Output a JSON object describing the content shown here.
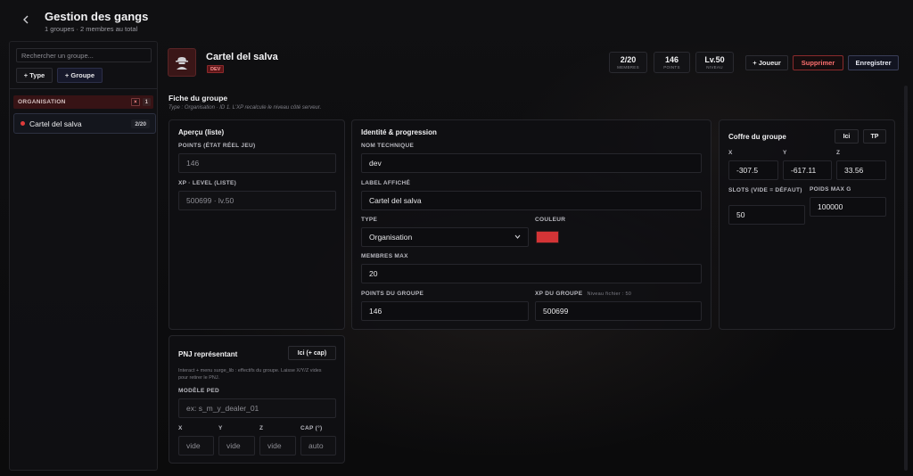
{
  "header": {
    "title": "Gestion des gangs",
    "subtitle": "1 groupes · 2 membres au total"
  },
  "sidebar": {
    "search_placeholder": "Rechercher un groupe...",
    "type_button": "+ Type",
    "group_button": "+ Groupe",
    "category": {
      "label": "ORGANISATION",
      "remove": "×",
      "count": "1"
    },
    "groups": [
      {
        "label": "Cartel del salva",
        "count": "2/20",
        "color": "#e03b3b"
      }
    ]
  },
  "group": {
    "name": "Cartel del salva",
    "badge": "DEV",
    "stats": [
      {
        "value": "2/20",
        "label": "MEMBRES"
      },
      {
        "value": "146",
        "label": "POINTS"
      },
      {
        "value": "Lv.50",
        "label": "NIVEAU"
      }
    ],
    "buttons": {
      "player": "+ Joueur",
      "delete": "Supprimer",
      "save": "Enregistrer"
    }
  },
  "form": {
    "title": "Fiche du groupe",
    "subtitle": "Type : Organisation · ID 1. L'XP recalcule le niveau côté serveur.",
    "overview": {
      "title": "Aperçu (liste)",
      "points_label": "POINTS (ÉTAT RÉEL JEU)",
      "points_value": "146",
      "xp_label": "XP · LEVEL (LISTE)",
      "xp_value": "500699 · lv.50"
    },
    "identity": {
      "title": "Identité & progression",
      "tech_name_label": "NOM TECHNIQUE",
      "tech_name_value": "dev",
      "display_label": "LABEL AFFICHÉ",
      "display_value": "Cartel del salva",
      "type_label": "TYPE",
      "type_value": "Organisation",
      "color_label": "COULEUR",
      "color_value": "#d33436",
      "max_members_label": "MEMBRES MAX",
      "max_members_value": "20",
      "group_points_label": "POINTS DU GROUPE",
      "group_points_value": "146",
      "group_xp_label": "XP DU GROUPE",
      "group_xp_hint": "Niveau fichier : 50",
      "group_xp_value": "500699"
    },
    "chest": {
      "title": "Coffre du groupe",
      "here_button": "Ici",
      "tp_button": "TP",
      "x_label": "X",
      "x_value": "-307.5",
      "y_label": "Y",
      "y_value": "-617.11",
      "z_label": "Z",
      "z_value": "33.56",
      "slots_label": "SLOTS (VIDE = DÉFAUT)",
      "slots_value": "50",
      "weight_label": "POIDS MAX G",
      "weight_value": "100000"
    },
    "npc": {
      "title": "PNJ représentant",
      "here_button": "Ici (+ cap)",
      "help": "Interact + menu surge_lib : effectifs du groupe. Laisse X/Y/Z vides pour retirer le PNJ.",
      "model_label": "MODÈLE PED",
      "model_placeholder": "ex: s_m_y_dealer_01",
      "x_label": "X",
      "x_placeholder": "vide",
      "y_label": "Y",
      "y_placeholder": "vide",
      "z_label": "Z",
      "z_placeholder": "vide",
      "cap_label": "CAP (°)",
      "cap_placeholder": "auto"
    }
  }
}
